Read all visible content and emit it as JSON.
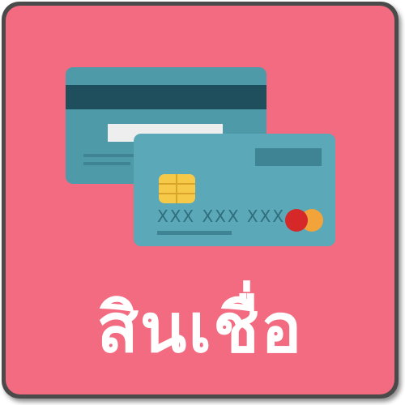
{
  "tile": {
    "label": "สินเชื่อ"
  },
  "front_card": {
    "number": "XXX XXX XXX"
  },
  "icons": {
    "illustration": "credit-cards-icon",
    "chip": "chip-icon",
    "brand": "mastercard-logo-icon"
  },
  "colors": {
    "tile_background": "#f26b80",
    "tile_border": "#4a4a4a",
    "card_back": "#4f9aa8",
    "card_stripe": "#1f4e5c",
    "card_front": "#5aa8b8",
    "chip": "#f7c948",
    "brand_red": "#d62828",
    "brand_orange": "#f2a33a",
    "label": "#ffffff"
  }
}
